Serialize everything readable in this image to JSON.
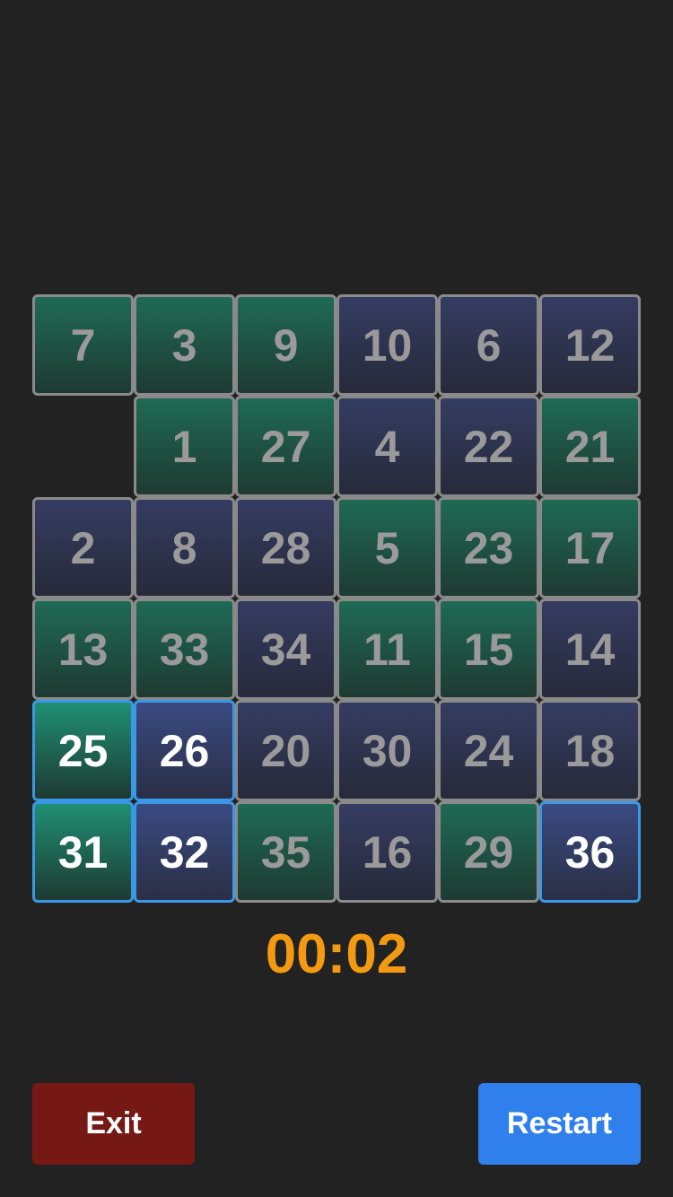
{
  "board": {
    "tiles": [
      {
        "label": "7",
        "color": "green",
        "placed": false
      },
      {
        "label": "3",
        "color": "green",
        "placed": false
      },
      {
        "label": "9",
        "color": "green",
        "placed": false
      },
      {
        "label": "10",
        "color": "navy",
        "placed": false
      },
      {
        "label": "6",
        "color": "navy",
        "placed": false
      },
      {
        "label": "12",
        "color": "navy",
        "placed": false
      },
      {
        "label": "",
        "color": "empty",
        "placed": false
      },
      {
        "label": "1",
        "color": "green",
        "placed": false
      },
      {
        "label": "27",
        "color": "green",
        "placed": false
      },
      {
        "label": "4",
        "color": "navy",
        "placed": false
      },
      {
        "label": "22",
        "color": "navy",
        "placed": false
      },
      {
        "label": "21",
        "color": "green",
        "placed": false
      },
      {
        "label": "2",
        "color": "navy",
        "placed": false
      },
      {
        "label": "8",
        "color": "navy",
        "placed": false
      },
      {
        "label": "28",
        "color": "navy",
        "placed": false
      },
      {
        "label": "5",
        "color": "green",
        "placed": false
      },
      {
        "label": "23",
        "color": "green",
        "placed": false
      },
      {
        "label": "17",
        "color": "green",
        "placed": false
      },
      {
        "label": "13",
        "color": "green",
        "placed": false
      },
      {
        "label": "33",
        "color": "green",
        "placed": false
      },
      {
        "label": "34",
        "color": "navy",
        "placed": false
      },
      {
        "label": "11",
        "color": "green",
        "placed": false
      },
      {
        "label": "15",
        "color": "green",
        "placed": false
      },
      {
        "label": "14",
        "color": "navy",
        "placed": false
      },
      {
        "label": "25",
        "color": "green",
        "placed": true
      },
      {
        "label": "26",
        "color": "navy",
        "placed": true
      },
      {
        "label": "20",
        "color": "navy",
        "placed": false
      },
      {
        "label": "30",
        "color": "navy",
        "placed": false
      },
      {
        "label": "24",
        "color": "navy",
        "placed": false
      },
      {
        "label": "18",
        "color": "navy",
        "placed": false
      },
      {
        "label": "31",
        "color": "green",
        "placed": true
      },
      {
        "label": "32",
        "color": "navy",
        "placed": true
      },
      {
        "label": "35",
        "color": "green",
        "placed": false
      },
      {
        "label": "16",
        "color": "navy",
        "placed": false
      },
      {
        "label": "29",
        "color": "green",
        "placed": false
      },
      {
        "label": "36",
        "color": "navy",
        "placed": true
      }
    ]
  },
  "timer": "00:02",
  "buttons": {
    "exit_label": "Exit",
    "restart_label": "Restart"
  },
  "colors": {
    "background": "#222222",
    "timer": "#f39a12",
    "exit": "#761915",
    "restart": "#2f80ed",
    "placed_border": "#3a98e6"
  }
}
